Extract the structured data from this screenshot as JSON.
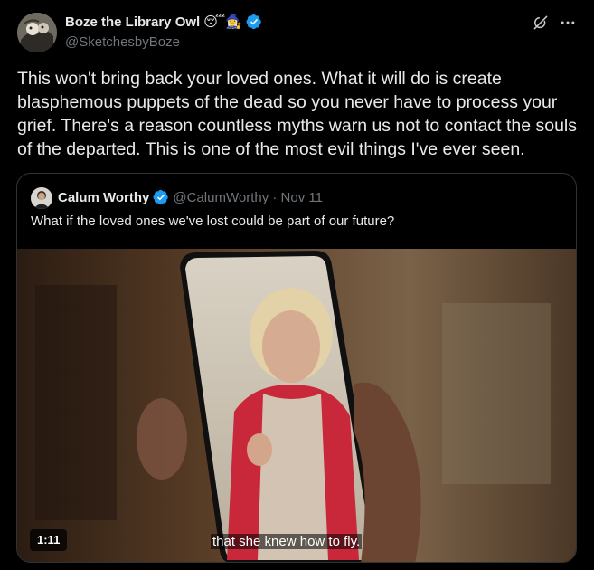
{
  "author": {
    "display_name": "Boze the Library Owl",
    "emojis": "😴🧙‍♀️",
    "handle": "@SketchesbyBoze",
    "verified": true
  },
  "actions": {
    "grok_icon": "grok-icon",
    "more_icon": "more-icon"
  },
  "tweet": {
    "text": "This won't bring back your loved ones. What it will do is create blasphemous puppets of the dead so you never have to process your grief. There's a reason countless myths warn us not to contact the souls of the departed. This is one of the most evil things I've ever seen."
  },
  "quote": {
    "display_name": "Calum Worthy",
    "verified": true,
    "meta": "@CalumWorthy · Nov 11",
    "text": "What if the loved ones we've lost could be part of our future?",
    "video": {
      "duration": "1:11",
      "caption": "that she knew how to fly."
    }
  },
  "colors": {
    "background": "#000000",
    "text": "#e7e9ea",
    "secondary_text": "#71767b",
    "border": "#2f3336",
    "verified_blue": "#1d9bf0"
  }
}
